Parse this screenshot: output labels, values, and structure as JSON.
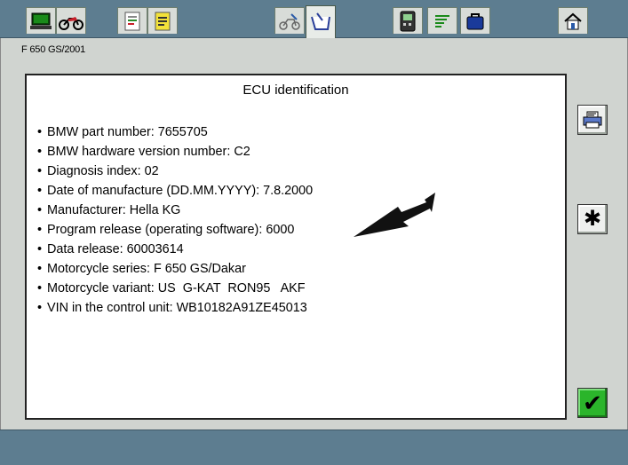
{
  "header": {
    "tabs": [
      {
        "icon": "laptop-icon"
      },
      {
        "icon": "motorcycle-icon"
      },
      {
        "icon": "document-list-icon"
      },
      {
        "icon": "notepad-icon"
      },
      {
        "icon": "vehicle-check-icon"
      },
      {
        "icon": "battery-tester-icon",
        "active": true
      },
      {
        "icon": "tester-device-icon"
      },
      {
        "icon": "text-lines-icon"
      },
      {
        "icon": "toolbox-icon"
      },
      {
        "icon": "home-icon"
      }
    ]
  },
  "vehicle_label": "F 650 GS/2001",
  "panel": {
    "title": "ECU identification",
    "items": [
      "BMW part number: 7655705",
      "BMW hardware version number: C2",
      "Diagnosis index: 02",
      "Date of manufacture (DD.MM.YYYY): 7.8.2000",
      "Manufacturer: Hella KG",
      "Program release (operating software): 6000",
      "Data release: 60003614",
      "Motorcycle series: F 650 GS/Dakar",
      "Motorcycle variant: US  G-KAT  RON95   AKF",
      "VIN in the control unit: WB10182A91ZE45013"
    ],
    "bullet": "•"
  },
  "side_buttons": {
    "print": {
      "icon": "printer-icon"
    },
    "star": {
      "icon": "asterisk-icon",
      "glyph": "✱"
    },
    "ok": {
      "icon": "checkmark-icon",
      "glyph": "✔",
      "color": "#2bb52b"
    }
  },
  "colors": {
    "bar": "#5d7d90",
    "background": "#d0d4d0"
  }
}
